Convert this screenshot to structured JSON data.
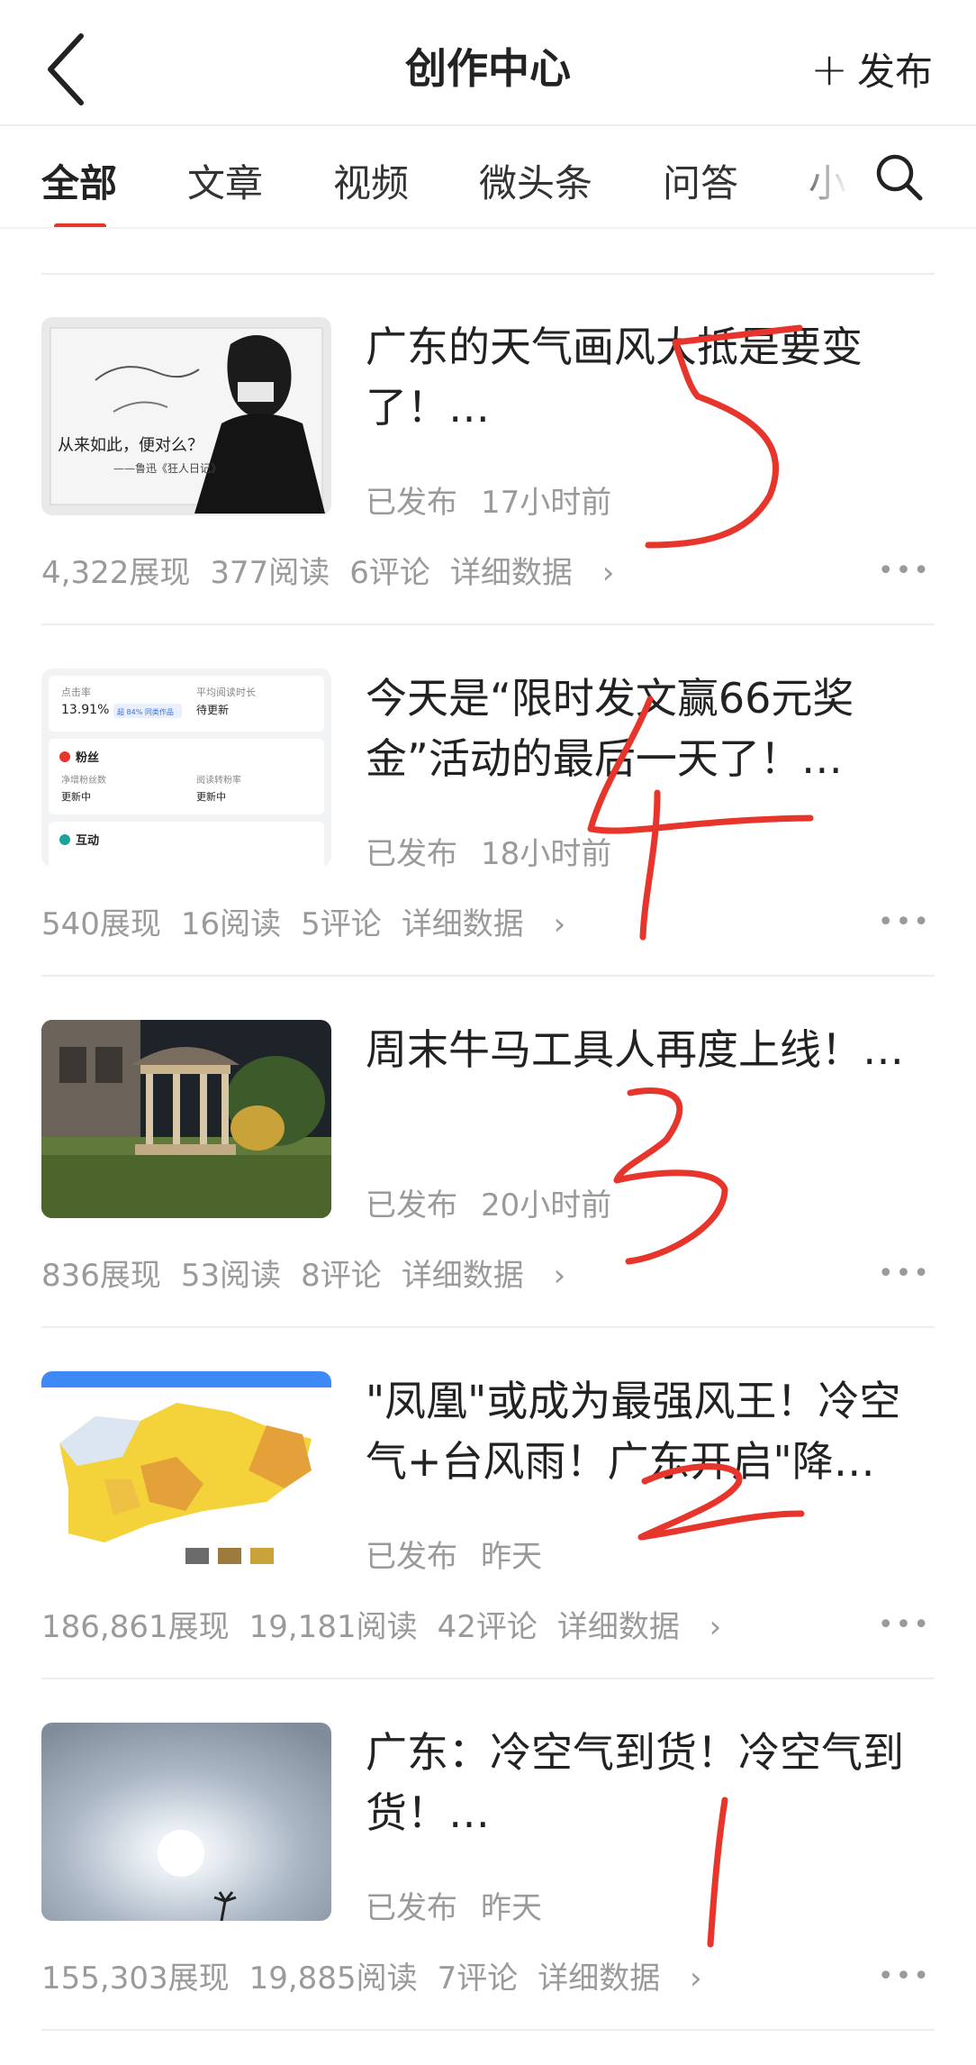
{
  "header": {
    "title": "创作中心",
    "publish_label": "发布"
  },
  "tabs": [
    "全部",
    "文章",
    "视频",
    "微头条",
    "问答",
    "小"
  ],
  "accent_color": "#e8352b",
  "articles": [
    {
      "title": "广东的天气画风大抵是要变了！…",
      "status": "已发布",
      "time": "17小时前",
      "impressions": "4,322展现",
      "reads": "377阅读",
      "comments": "6评论",
      "detail": "详细数据",
      "thumb_text": "从来如此，便对么？",
      "thumb_sub": "——鲁迅《狂人日记》",
      "annotation": "5"
    },
    {
      "title": "今天是“限时发文赢66元奖金”活动的最后一天了！…",
      "status": "已发布",
      "time": "18小时前",
      "impressions": "540展现",
      "reads": "16阅读",
      "comments": "5评论",
      "detail": "详细数据",
      "thumb_rows": [
        {
          "k1": "点击率",
          "v1": "13.91%",
          "tag": "超 84% 同类作品",
          "k2": "平均阅读时长",
          "v2": "待更新"
        },
        {
          "head": "粉丝",
          "k1": "净增粉丝数",
          "v1": "更新中",
          "k2": "阅读转粉率",
          "v2": "更新中"
        },
        {
          "head": "互动"
        }
      ],
      "annotation": "4"
    },
    {
      "title": "周末牛马工具人再度上线！…",
      "status": "已发布",
      "time": "20小时前",
      "impressions": "836展现",
      "reads": "53阅读",
      "comments": "8评论",
      "detail": "详细数据",
      "annotation": "3"
    },
    {
      "title": "\"凤凰\"或成为最强风王！冷空气+台风雨！广东开启\"降温\"模式",
      "status": "已发布",
      "time": "昨天",
      "impressions": "186,861展现",
      "reads": "19,181阅读",
      "comments": "42评论",
      "detail": "详细数据",
      "annotation": "2"
    },
    {
      "title": "广东：冷空气到货！冷空气到货！…",
      "status": "已发布",
      "time": "昨天",
      "impressions": "155,303展现",
      "reads": "19,885阅读",
      "comments": "7评论",
      "detail": "详细数据",
      "annotation": "1"
    }
  ]
}
